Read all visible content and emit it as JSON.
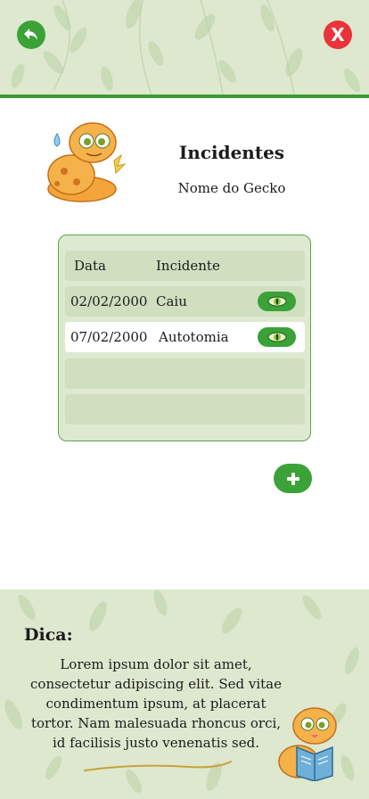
{
  "header": {
    "back_icon": "back-arrow-icon",
    "close_label": "X"
  },
  "title": "Incidentes",
  "gecko_name": "Nome do Gecko",
  "table": {
    "columns": [
      "Data",
      "Incidente"
    ],
    "rows": [
      {
        "date": "02/02/2000",
        "incident": "Caiu",
        "action_icon": "eye-icon"
      },
      {
        "date": "07/02/2000",
        "incident": "Autotomia",
        "action_icon": "eye-icon"
      }
    ]
  },
  "add_icon": "plus-icon",
  "tip": {
    "title": "Dica:",
    "text": "Lorem ipsum dolor sit amet, consectetur adipiscing elit. Sed vitae condimentum ipsum, at placerat tortor. Nam malesuada rhoncus orci, id facilisis justo venenatis sed."
  },
  "colors": {
    "primary_green": "#3aa236",
    "close_red": "#e8343a",
    "pattern_bg": "#dde8cf",
    "table_bg": "#dfe9d2",
    "row_bg": "#cfdfc0"
  }
}
